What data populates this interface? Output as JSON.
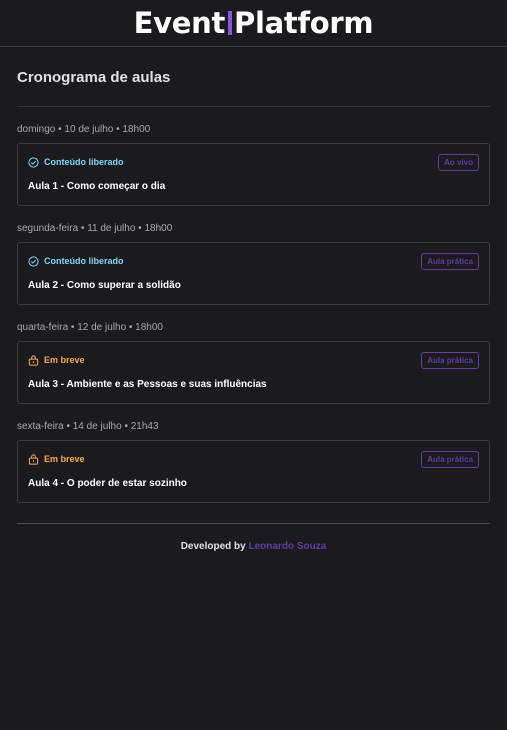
{
  "header": {
    "brand_left": "Event",
    "brand_right": "Platform"
  },
  "page": {
    "title": "Cronograma de aulas"
  },
  "lessons": [
    {
      "date": "domingo • 10 de julho • 18h00",
      "status": "Conteúdo liberado",
      "status_type": "available",
      "badge": "Ao vivo",
      "title": "Aula 1 - Como começar o dia"
    },
    {
      "date": "segunda-feira • 11 de julho • 18h00",
      "status": "Conteúdo liberado",
      "status_type": "available",
      "badge": "Aula prática",
      "title": "Aula 2 - Como superar a solidão"
    },
    {
      "date": "quarta-feira • 12 de julho • 18h00",
      "status": "Em breve",
      "status_type": "soon",
      "badge": "Aula prática",
      "title": "Aula 3 - Ambiente e as Pessoas e suas influências"
    },
    {
      "date": "sexta-feira • 14 de julho • 21h43",
      "status": "Em breve",
      "status_type": "soon",
      "badge": "Aula prática",
      "title": "Aula 4 - O poder de estar sozinho"
    }
  ],
  "footer": {
    "prefix": "Developed by ",
    "author": "Leonardo Souza"
  },
  "colors": {
    "background": "#1b1b1e",
    "accent": "#8257e5",
    "badge": "#633ba3",
    "available": "#81d8f7",
    "soon": "#fba94c"
  },
  "icons": {
    "available": "check-circle-icon",
    "soon": "lock-icon"
  }
}
